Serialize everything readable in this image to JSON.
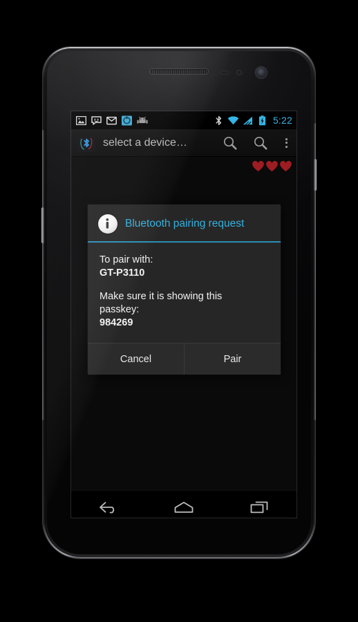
{
  "device": {
    "name": "android-phone-mockup",
    "hardware": {
      "earpiece": "earpiece-speaker",
      "proximity_sensor": "proximity-sensor",
      "light_sensor": "light-sensor",
      "front_camera": "front-camera",
      "volume_button": "volume-rocker",
      "power_button": "power-button"
    }
  },
  "status_bar": {
    "left_icons": [
      {
        "name": "gallery-icon",
        "label": "Gallery"
      },
      {
        "name": "messaging-icon",
        "label": "Messaging"
      },
      {
        "name": "gmail-icon",
        "label": "Gmail"
      },
      {
        "name": "app-notification-icon",
        "label": "App"
      },
      {
        "name": "android-icon",
        "label": "Android"
      }
    ],
    "right_icons": [
      {
        "name": "bluetooth-icon",
        "label": "Bluetooth"
      },
      {
        "name": "wifi-icon",
        "label": "Wi-Fi"
      },
      {
        "name": "cellular-signal-icon",
        "label": "Signal"
      },
      {
        "name": "battery-charging-icon",
        "label": "Battery charging"
      }
    ],
    "clock": "5:22",
    "accent_color": "#33b5e5"
  },
  "action_bar": {
    "app_icon": "bluetooth-app-icon",
    "title": "select a device…",
    "actions": [
      {
        "name": "search-icon",
        "label": "Search"
      },
      {
        "name": "search-icon-secondary",
        "label": "Search"
      },
      {
        "name": "overflow-menu-icon",
        "label": "More options"
      }
    ]
  },
  "content": {
    "hearts": [
      {
        "name": "heart-icon-1",
        "color": "#a01f1f"
      },
      {
        "name": "heart-icon-2",
        "color": "#a01f1f"
      },
      {
        "name": "heart-icon-3",
        "color": "#a01f1f"
      }
    ]
  },
  "dialog": {
    "icon": "info-icon",
    "title": "Bluetooth pairing request",
    "title_color": "#34b1dd",
    "divider_color": "#2a8fb8",
    "lines": [
      {
        "text": "To pair with:",
        "bold": false
      },
      {
        "text": "GT-P3110",
        "bold": true
      },
      {
        "text": "Make sure it is showing this",
        "bold": false
      },
      {
        "text": "passkey:",
        "bold": false
      },
      {
        "text": "984269",
        "bold": true
      }
    ],
    "buttons": [
      {
        "name": "cancel-button",
        "label": "Cancel"
      },
      {
        "name": "pair-button",
        "label": "Pair"
      }
    ]
  },
  "nav_bar": {
    "buttons": [
      {
        "name": "back-button",
        "label": "Back"
      },
      {
        "name": "home-button",
        "label": "Home"
      },
      {
        "name": "recents-button",
        "label": "Recent apps"
      }
    ]
  }
}
